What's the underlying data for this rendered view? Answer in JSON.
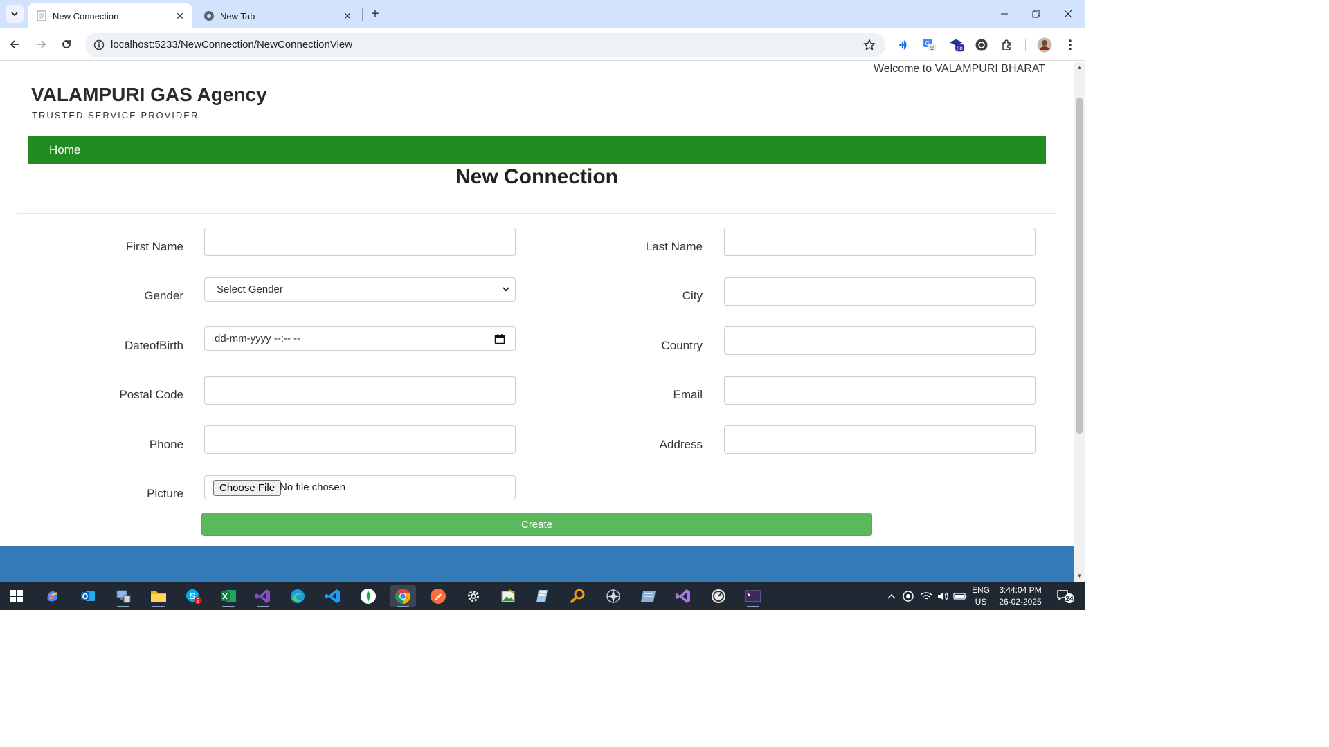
{
  "browser": {
    "tabs": [
      {
        "title": "New Connection",
        "active": true
      },
      {
        "title": "New Tab",
        "active": false
      }
    ],
    "url": "localhost:5233/NewConnection/NewConnectionView",
    "extension_badge": "30"
  },
  "header": {
    "welcome": "Welcome to VALAMPURI BHARAT",
    "brand": "VALAMPURI GAS Agency",
    "tagline": "TRUSTED SERVICE PROVIDER",
    "nav_home": "Home"
  },
  "page": {
    "title": "New Connection"
  },
  "form": {
    "labels": {
      "first_name": "First Name",
      "last_name": "Last Name",
      "gender": "Gender",
      "city": "City",
      "dob": "DateofBirth",
      "country": "Country",
      "postal_code": "Postal Code",
      "email": "Email",
      "phone": "Phone",
      "address": "Address",
      "picture": "Picture"
    },
    "gender_selected": "Select Gender",
    "dob_placeholder": "dd-mm-yyyy --:-- --",
    "file_button": "Choose File",
    "file_status": "No file chosen",
    "submit": "Create"
  },
  "taskbar": {
    "lang_top": "ENG",
    "lang_bottom": "US",
    "time": "3:44:04 PM",
    "date": "26-02-2025",
    "notifications": "24",
    "skype_badge": "2"
  },
  "colors": {
    "nav_green": "#228b22",
    "create_green": "#5cb85c",
    "footer_blue": "#337ab7",
    "tabstrip": "#d3e3fd"
  }
}
